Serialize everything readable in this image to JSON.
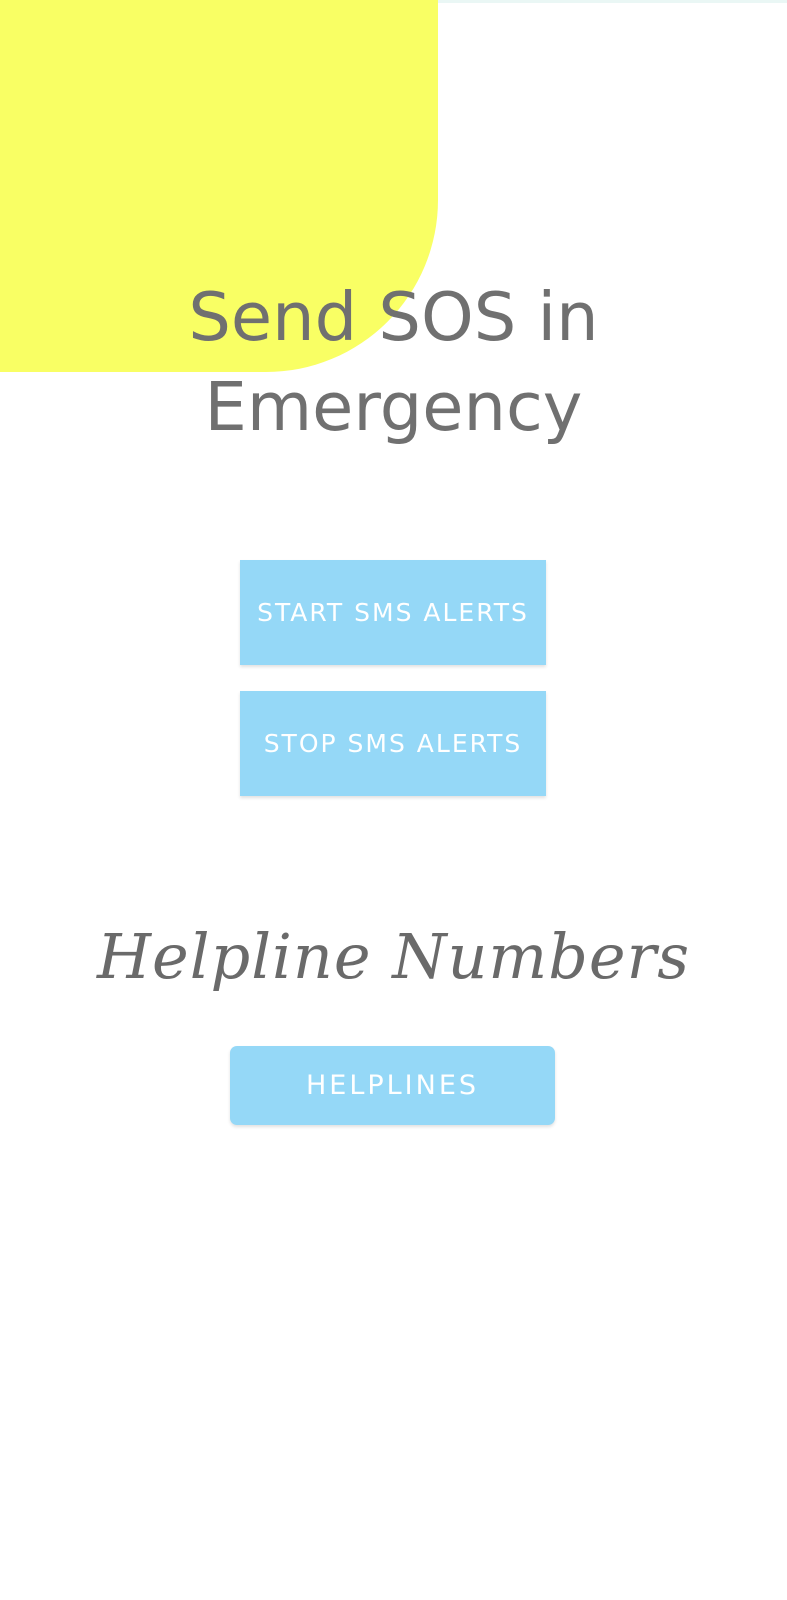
{
  "header": {
    "title_line1": "Send SOS in",
    "title_line2": "Emergency"
  },
  "alerts": {
    "start_label": "START SMS ALERTS",
    "stop_label": "STOP SMS ALERTS"
  },
  "helplines": {
    "heading": "Helpline Numbers",
    "button_label": "HELPLINES"
  },
  "colors": {
    "accent_yellow": "#f9ff64",
    "button_blue": "#95d8f7",
    "title_gray": "#707070"
  }
}
